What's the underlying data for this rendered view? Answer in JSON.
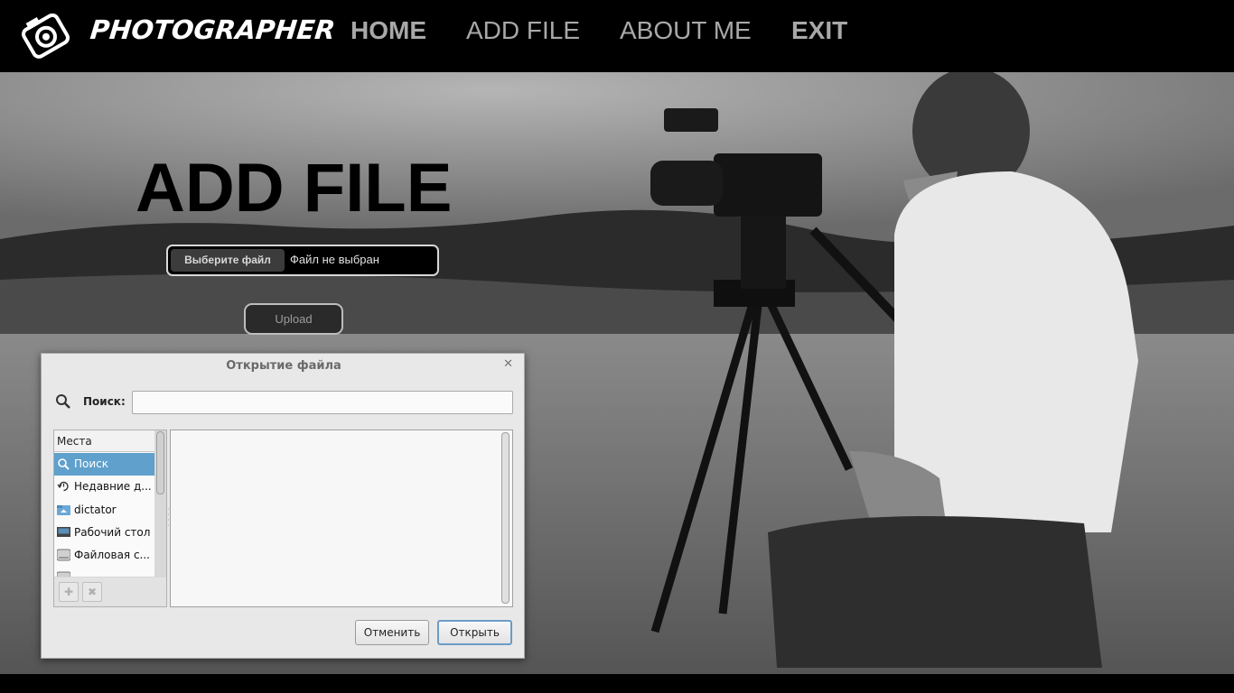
{
  "header": {
    "brand": "PHOTOGRAPHER",
    "nav": [
      {
        "label": "HOME"
      },
      {
        "label": "ADD FILE"
      },
      {
        "label": "ABOUT ME"
      },
      {
        "label": "EXIT"
      }
    ]
  },
  "main": {
    "title": "ADD FILE",
    "file_input": {
      "button_label": "Выберите файл",
      "status": "Файл не выбран"
    },
    "upload_label": "Upload"
  },
  "dialog": {
    "title": "Открытие файла",
    "close_icon": "close-icon",
    "search_label": "Поиск:",
    "search_value": "",
    "places_header": "Места",
    "places": [
      {
        "label": "Поиск",
        "icon": "search-icon",
        "selected": true
      },
      {
        "label": "Недавние д...",
        "icon": "recent-icon"
      },
      {
        "label": "dictator",
        "icon": "home-folder-icon"
      },
      {
        "label": "Рабочий стол",
        "icon": "desktop-icon"
      },
      {
        "label": "Файловая с...",
        "icon": "drive-icon"
      }
    ],
    "cancel_label": "Отменить",
    "open_label": "Открыть"
  },
  "colors": {
    "header_bg": "#000000",
    "nav_text": "#a8a8a8",
    "selected_place": "#5fa0cc",
    "open_button_border": "#6b9cc7"
  }
}
